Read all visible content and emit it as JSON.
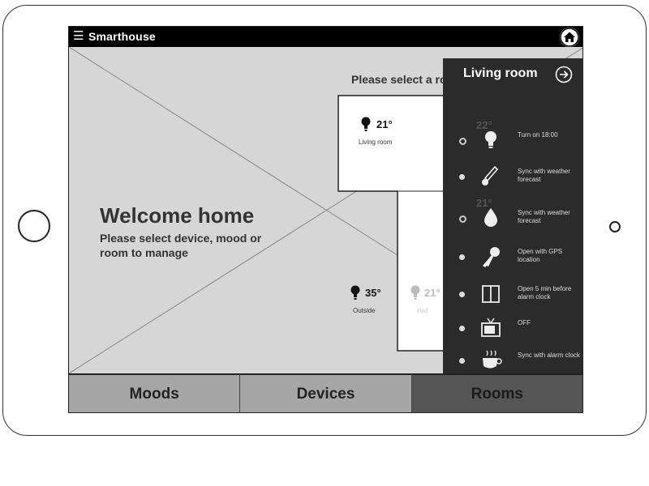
{
  "app": {
    "title": "Smarthouse"
  },
  "welcome": {
    "title": "Welcome home",
    "subtitle": "Please select device, mood or room to manage"
  },
  "floorplan": {
    "prompt": "Please select a room",
    "sensors": [
      {
        "temp": "21°",
        "room": "Living room"
      },
      {
        "temp": "35°",
        "room": "Outside"
      },
      {
        "temp": "21°",
        "room": "Hall"
      },
      {
        "temp": "22°",
        "room": ""
      },
      {
        "temp": "21°",
        "room": ""
      }
    ]
  },
  "tabs": [
    {
      "label": "Moods",
      "active": false
    },
    {
      "label": "Devices",
      "active": false
    },
    {
      "label": "Rooms",
      "active": true
    }
  ],
  "panel": {
    "title": "Living room",
    "items": [
      {
        "icon": "light-bulb-icon",
        "label": "Turn on 18:00",
        "selected": false
      },
      {
        "icon": "thermometer-icon",
        "label": "Sync with weather forecast",
        "selected": true
      },
      {
        "icon": "water-drop-icon",
        "label": "Sync with weather forecast",
        "selected": false
      },
      {
        "icon": "key-icon",
        "label": "Open with GPS location",
        "selected": true
      },
      {
        "icon": "window-icon",
        "label": "Open 5 min before alarm clock",
        "selected": true
      },
      {
        "icon": "tv-icon",
        "label": "OFF",
        "selected": true
      },
      {
        "icon": "coffee-cup-icon",
        "label": "Sync with alarm clock",
        "selected": true
      }
    ]
  },
  "colors": {
    "topbar": "#000000",
    "screen_bg": "#d6d6d6",
    "panel_bg": "#2b2b2b",
    "tab_bg": "#a6a6a6",
    "tab_active_bg": "#555555"
  }
}
